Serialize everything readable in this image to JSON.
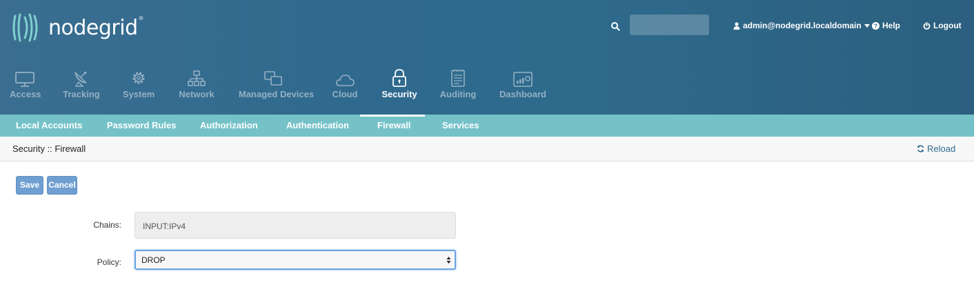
{
  "brand": {
    "name": "nodegrid",
    "reg": "®"
  },
  "header": {
    "user": "admin@nodegrid.localdomain",
    "help": "Help",
    "logout": "Logout"
  },
  "nav": {
    "items": [
      {
        "label": "Access",
        "icon": "monitor-icon"
      },
      {
        "label": "Tracking",
        "icon": "satellite-dish-icon"
      },
      {
        "label": "System",
        "icon": "gear-icon"
      },
      {
        "label": "Network",
        "icon": "network-icon"
      },
      {
        "label": "Managed Devices",
        "icon": "devices-icon"
      },
      {
        "label": "Cloud",
        "icon": "cloud-icon"
      },
      {
        "label": "Security",
        "icon": "lock-icon",
        "active": true
      },
      {
        "label": "Auditing",
        "icon": "clipboard-icon"
      },
      {
        "label": "Dashboard",
        "icon": "dashboard-icon"
      }
    ]
  },
  "subnav": {
    "items": [
      "Local Accounts",
      "Password Rules",
      "Authorization",
      "Authentication",
      "Firewall",
      "Services"
    ],
    "active": "Firewall"
  },
  "breadcrumb": "Security :: Firewall",
  "reload": "Reload",
  "actions": {
    "save": "Save",
    "cancel": "Cancel"
  },
  "form": {
    "chains_label": "Chains:",
    "chains_value": "INPUT:IPv4",
    "policy_label": "Policy:",
    "policy_value": "DROP"
  },
  "colors": {
    "header": "#2f6a8e",
    "subnav": "#74c2c8",
    "button": "#6f9fd0",
    "nav_inactive": "#93b0c4"
  }
}
